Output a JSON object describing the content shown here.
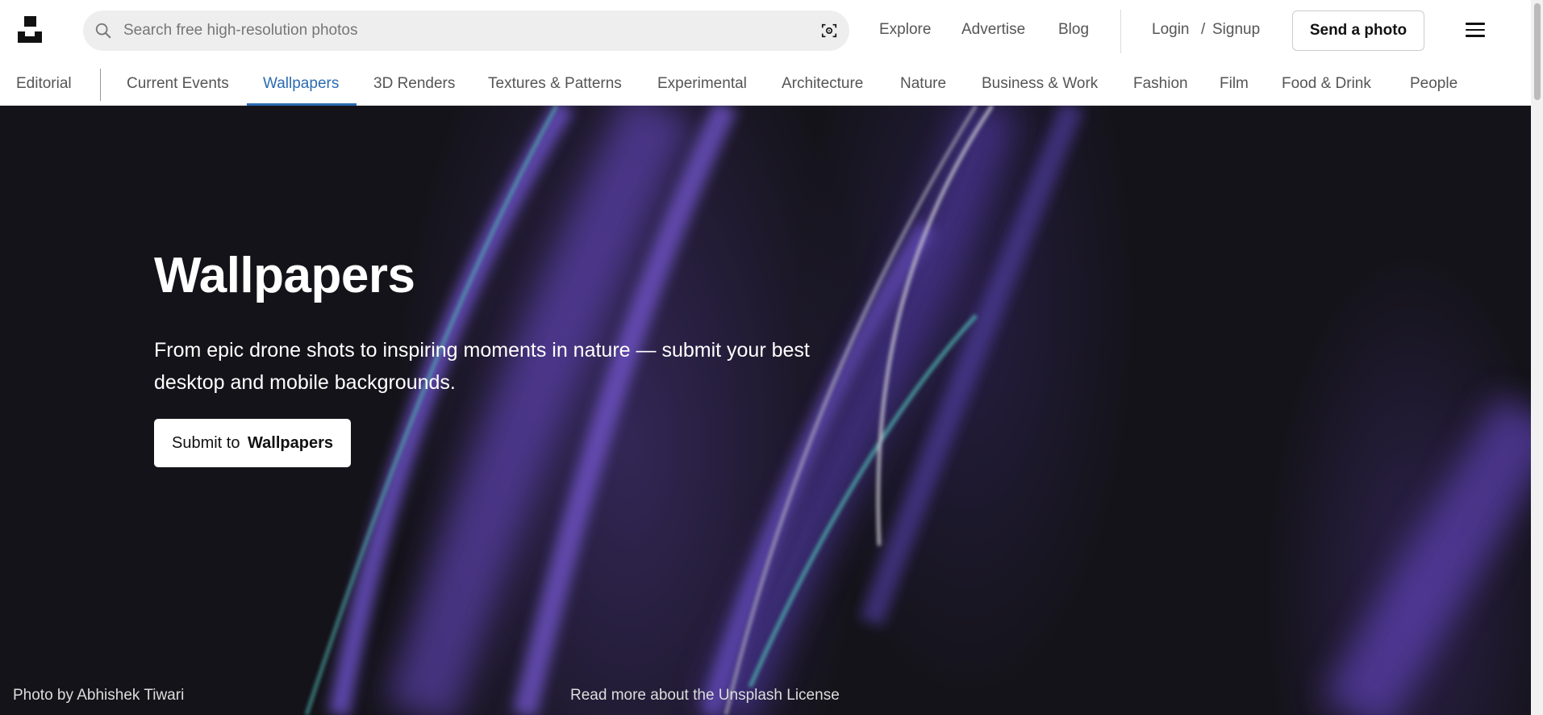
{
  "header": {
    "search": {
      "placeholder": "Search free high-resolution photos",
      "value": ""
    },
    "nav": {
      "explore": "Explore",
      "advertise": "Advertise",
      "blog": "Blog"
    },
    "auth": {
      "login": "Login",
      "separator": "/",
      "signup": "Signup"
    },
    "send_photo_label": "Send a photo"
  },
  "topics": {
    "editorial": "Editorial",
    "items": [
      {
        "label": "Current Events"
      },
      {
        "label": "Wallpapers",
        "active": true
      },
      {
        "label": "3D Renders"
      },
      {
        "label": "Textures & Patterns"
      },
      {
        "label": "Experimental"
      },
      {
        "label": "Architecture"
      },
      {
        "label": "Nature"
      },
      {
        "label": "Business & Work"
      },
      {
        "label": "Fashion"
      },
      {
        "label": "Film"
      },
      {
        "label": "Food & Drink"
      },
      {
        "label": "People"
      }
    ]
  },
  "hero": {
    "title": "Wallpapers",
    "subtitle_line1": "From epic drone shots to inspiring moments in nature — submit your best",
    "subtitle_line2": "desktop and mobile backgrounds.",
    "submit_prefix": "Submit to",
    "submit_topic": "Wallpapers",
    "credit_prefix": "Photo by",
    "credit_author": "Abhishek Tiwari",
    "license_text": "Read more about the Unsplash License"
  },
  "colors": {
    "accent": "#2b6cb0",
    "hero_bg": "#141319",
    "streak_purple": "#6a4fc4",
    "streak_teal": "#4fb3b0"
  }
}
